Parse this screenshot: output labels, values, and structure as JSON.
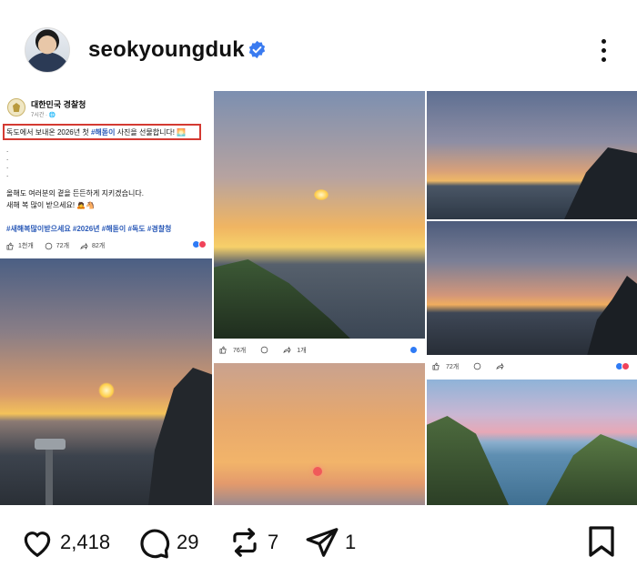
{
  "header": {
    "username": "seokyoungduk",
    "verified": true,
    "avatar_icon": "profile-avatar",
    "more_icon": "more-vertical-icon"
  },
  "fb_card": {
    "page_name": "대한민국 경찰청",
    "time": "7시간 · 🌐",
    "line1_prefix": "독도에서 보내온 2026년 첫 ",
    "line1_tag": "#해돋이",
    "line1_suffix": " 사진을 선물합니다! 🌅",
    "dots": ".\n.\n.\n.",
    "line2": "올해도 여러분의 곁을 든든하게 지키겠습니다.",
    "line3": "새해 복 많이 받으세요! 🙇🐴",
    "hashtags": "#새해복많이받으세요 #2026년 #해돋이 #독도 #경찰청",
    "likes": "1천개",
    "comments": "72개",
    "shares": "82개"
  },
  "photo_b_bar": {
    "likes": "76개",
    "shares": "1개"
  },
  "photo_e_bar": {
    "likes": "72개"
  },
  "actions": {
    "likes": "2,418",
    "comments": "29",
    "reposts": "7",
    "shares": "1"
  },
  "colors": {
    "verified_blue": "#3a7bf0",
    "hashtag_blue": "#2c5bb8",
    "highlight_red": "#d43a32"
  }
}
